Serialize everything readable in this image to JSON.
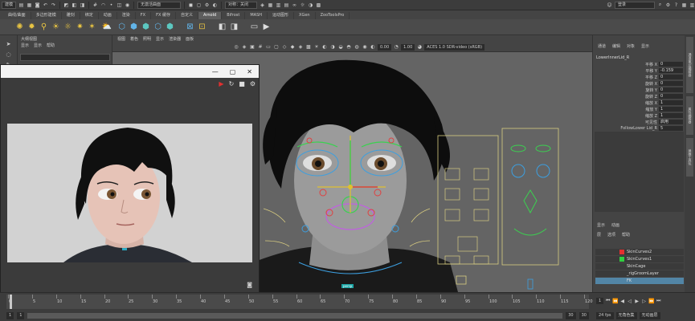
{
  "statusline": {
    "mode_dropdown": "建模",
    "no_live_surface": "无激活曲面",
    "symmetry": "对称：关闭",
    "login": "登录"
  },
  "shelf_tabs": [
    "曲线/曲面",
    "多边形建模",
    "雕刻",
    "绑定",
    "动画",
    "渲染",
    "FX",
    "FX 缓存",
    "自定义",
    "Arnold",
    "Bifrost",
    "MASH",
    "运动图形",
    "XGen",
    "ZooToolsPro"
  ],
  "shelf_active_tab": "Arnold",
  "outliner_tl": {
    "title": "大纲视图",
    "menu": [
      "显示",
      "显示",
      "帮助"
    ]
  },
  "viewport": {
    "menu": [
      "视图",
      "着色",
      "照明",
      "显示",
      "渲染器",
      "面板"
    ],
    "value_a": "0.00",
    "value_b": "1.00",
    "color_space": "ACES 1.0 SDR-video (sRGB)",
    "camera_label": "persp"
  },
  "channel_box": {
    "tabs": [
      "通道",
      "编辑",
      "对象",
      "显示"
    ],
    "node_name": "LowerInnerLid_R",
    "rows": [
      {
        "label": "平移 X",
        "value": "0"
      },
      {
        "label": "平移 Y",
        "value": "-0.159"
      },
      {
        "label": "平移 Z",
        "value": "0"
      },
      {
        "label": "旋转 X",
        "value": "0"
      },
      {
        "label": "旋转 Y",
        "value": "0"
      },
      {
        "label": "旋转 Z",
        "value": "0"
      },
      {
        "label": "缩放 X",
        "value": "1"
      },
      {
        "label": "缩放 Y",
        "value": "1"
      },
      {
        "label": "缩放 Z",
        "value": "1"
      },
      {
        "label": "可见性",
        "value": "启用"
      },
      {
        "label": "FollowLower Lid_R",
        "value": "5"
      }
    ]
  },
  "side_tabs": [
    "通道盒/层编辑器",
    "属性编辑器",
    "建模工具包"
  ],
  "layers": {
    "tabs": [
      "显示",
      "动画"
    ],
    "menu": [
      "层",
      "选项",
      "帮助"
    ],
    "items": [
      {
        "name": "SkinCurves2",
        "color": "#e53030"
      },
      {
        "name": "SkinCurves1",
        "color": "#30d040"
      },
      {
        "name": "SkinCage",
        "color": ""
      },
      {
        "name": "_rigGroomLayer",
        "color": ""
      },
      {
        "name": "FK",
        "color": "",
        "selected": true
      }
    ]
  },
  "timeline": {
    "tick_labels": [
      "0",
      "5",
      "10",
      "15",
      "20",
      "25",
      "30",
      "35",
      "40",
      "45",
      "50",
      "55",
      "60",
      "65",
      "70",
      "75",
      "80",
      "85",
      "90",
      "95",
      "100",
      "105",
      "110",
      "115",
      "120"
    ],
    "current_frame": "1",
    "range_start": "1",
    "range_end": "30",
    "anim_end": "30",
    "fps": "24 fps",
    "no_char_set": "无角色集",
    "no_anim_layer": "无动画层"
  }
}
